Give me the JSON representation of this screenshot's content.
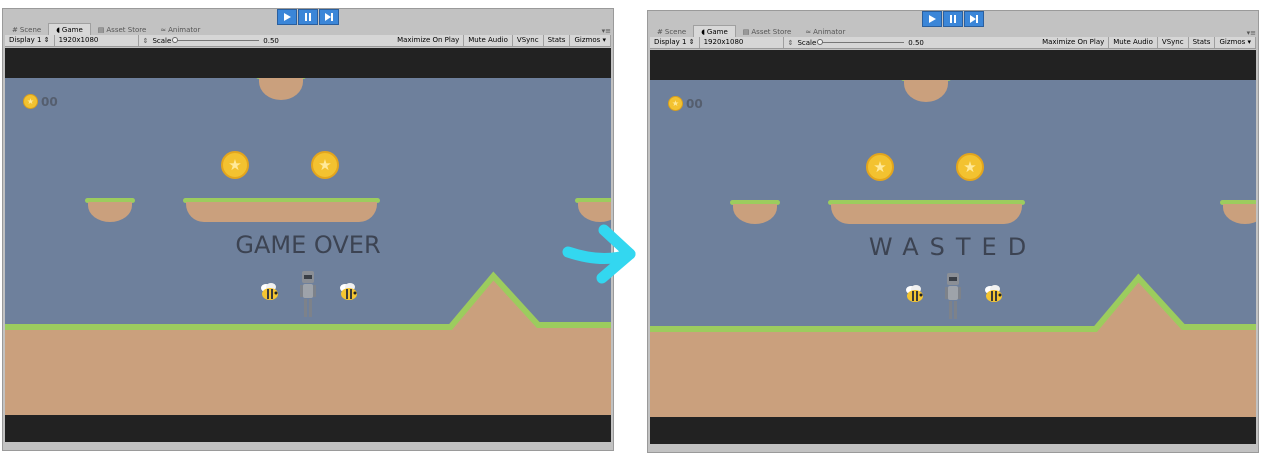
{
  "tabs": [
    {
      "label": "Scene",
      "icon": "grid-icon"
    },
    {
      "label": "Game",
      "icon": "pacman-icon"
    },
    {
      "label": "Asset Store",
      "icon": "store-icon"
    },
    {
      "label": "Animator",
      "icon": "animator-icon"
    }
  ],
  "toolbar": {
    "display": "Display 1",
    "resolution": "1920x1080",
    "scale_label": "Scale",
    "scale_value": "0.50",
    "maximize": "Maximize On Play",
    "mute": "Mute Audio",
    "vsync": "VSync",
    "stats": "Stats",
    "gizmos": "Gizmos"
  },
  "hud": {
    "coin_count": "00"
  },
  "left": {
    "overlay_text": "GAME OVER"
  },
  "right": {
    "overlay_text": "WASTED"
  },
  "colors": {
    "sky": "#6e809c",
    "grass": "#9ccc5e",
    "dirt": "#caa07d",
    "coin": "#f3c230",
    "arrow": "#33d7f0",
    "play_button": "#3b86d8"
  }
}
